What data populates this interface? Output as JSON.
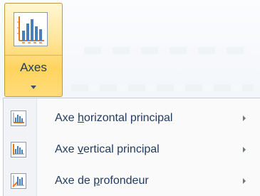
{
  "ribbon": {
    "axes_button": {
      "label": "Axes",
      "icon": "chart-axes-icon",
      "dropdown_icon": "chevron-down-icon"
    }
  },
  "menu": {
    "items": [
      {
        "pre": "Axe ",
        "accel": "h",
        "post": "orizontal principal",
        "icon": "horizontal-axis-icon",
        "submenu_icon": "chevron-right-icon"
      },
      {
        "pre": "Axe ",
        "accel": "v",
        "post": "ertical principal",
        "icon": "vertical-axis-icon",
        "submenu_icon": "chevron-right-icon"
      },
      {
        "pre": "Axe de ",
        "accel": "p",
        "post": "rofondeur",
        "icon": "depth-axis-icon",
        "submenu_icon": "chevron-right-icon"
      }
    ]
  },
  "colors": {
    "highlight_border": "#c29b3d",
    "highlight_fill": "#ffd35e",
    "text": "#1e3a5f",
    "axis_orange": "#e07a1f",
    "bar_blue": "#4a7ebb"
  }
}
